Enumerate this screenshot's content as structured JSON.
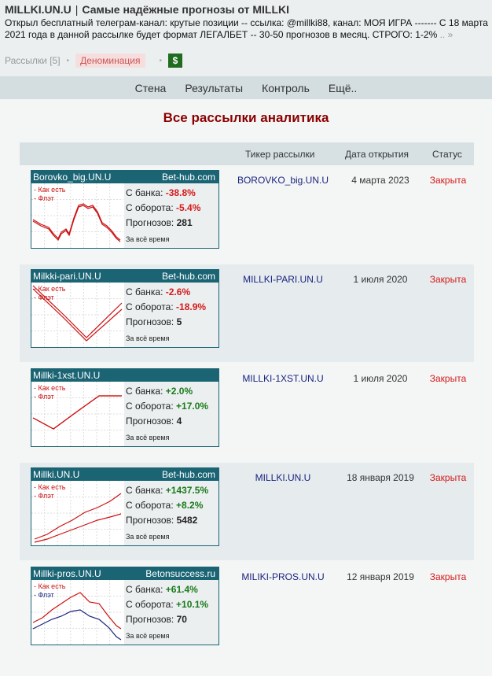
{
  "header": {
    "site": "MILLKI.UN.U",
    "separator": "|",
    "tagline": "Самые надёжные прогнозы от MILLKI",
    "description": "Открыл бесплатный телеграм-канал: крутые позиции -- ссылка: @millki88, канал: МОЯ ИГРА ------- С 18 марта 2021 года в данной рассылке будет формат ЛЕГАЛБЕТ -- 30-50 прогнозов в месяц. СТРОГО: 1-2%",
    "more": ".. »",
    "links": {
      "subscriptions": "Рассылки [5]",
      "denomination": "Деноминация",
      "dollar": "$"
    }
  },
  "nav": [
    "Стена",
    "Результаты",
    "Контроль",
    "Ещё.."
  ],
  "page_title": "Все рассылки аналитика",
  "table": {
    "headers": {
      "ticker": "Тикер рассылки",
      "date": "Дата открытия",
      "status": "Статус"
    },
    "legend": {
      "as_is": "- Как есть",
      "flat": "- Флэт"
    },
    "labels": {
      "bank": "С банка:",
      "turnover": "С оборота:",
      "forecasts": "Прогнозов:",
      "period": "За всё время"
    },
    "rows": [
      {
        "card_name": "Borovko_big.UN.U",
        "provider": "Bet-hub.com",
        "bank": "-38.8%",
        "turnover": "-5.4%",
        "forecasts": "281",
        "bank_sign": "neg",
        "turnover_sign": "neg",
        "ticker": "BOROVKO_big.UN.U",
        "date": "4 марта 2023",
        "status": "Закрыта",
        "line_colors": [
          "#cc1111",
          "#cc1111"
        ]
      },
      {
        "card_name": "Milkki-pari.UN.U",
        "provider": "Bet-hub.com",
        "bank": "-2.6%",
        "turnover": "-18.9%",
        "forecasts": "5",
        "bank_sign": "neg",
        "turnover_sign": "neg",
        "ticker": "MILLKI-PARI.UN.U",
        "date": "1 июля 2020",
        "status": "Закрыта",
        "line_colors": [
          "#cc1111",
          "#cc1111"
        ]
      },
      {
        "card_name": "Millki-1xst.UN.U",
        "provider": "",
        "bank": "+2.0%",
        "turnover": "+17.0%",
        "forecasts": "4",
        "bank_sign": "pos",
        "turnover_sign": "pos",
        "ticker": "MILLKI-1XST.UN.U",
        "date": "1 июля 2020",
        "status": "Закрыта",
        "line_colors": [
          "#cc1111",
          "#cc1111"
        ]
      },
      {
        "card_name": "Millki.UN.U",
        "provider": "Bet-hub.com",
        "bank": "+1437.5%",
        "turnover": "+8.2%",
        "forecasts": "5482",
        "bank_sign": "pos",
        "turnover_sign": "pos",
        "ticker": "MILLKI.UN.U",
        "date": "18 января 2019",
        "status": "Закрыта",
        "line_colors": [
          "#cc1111",
          "#cc1111"
        ]
      },
      {
        "card_name": "Millki-pros.UN.U",
        "provider": "Betonsuccess.ru",
        "bank": "+61.4%",
        "turnover": "+10.1%",
        "forecasts": "70",
        "bank_sign": "pos",
        "turnover_sign": "pos",
        "ticker": "MILIKI-PROS.UN.U",
        "date": "12 января 2019",
        "status": "Закрыта",
        "line_colors": [
          "#cc1111",
          "#1a237e"
        ]
      }
    ]
  }
}
